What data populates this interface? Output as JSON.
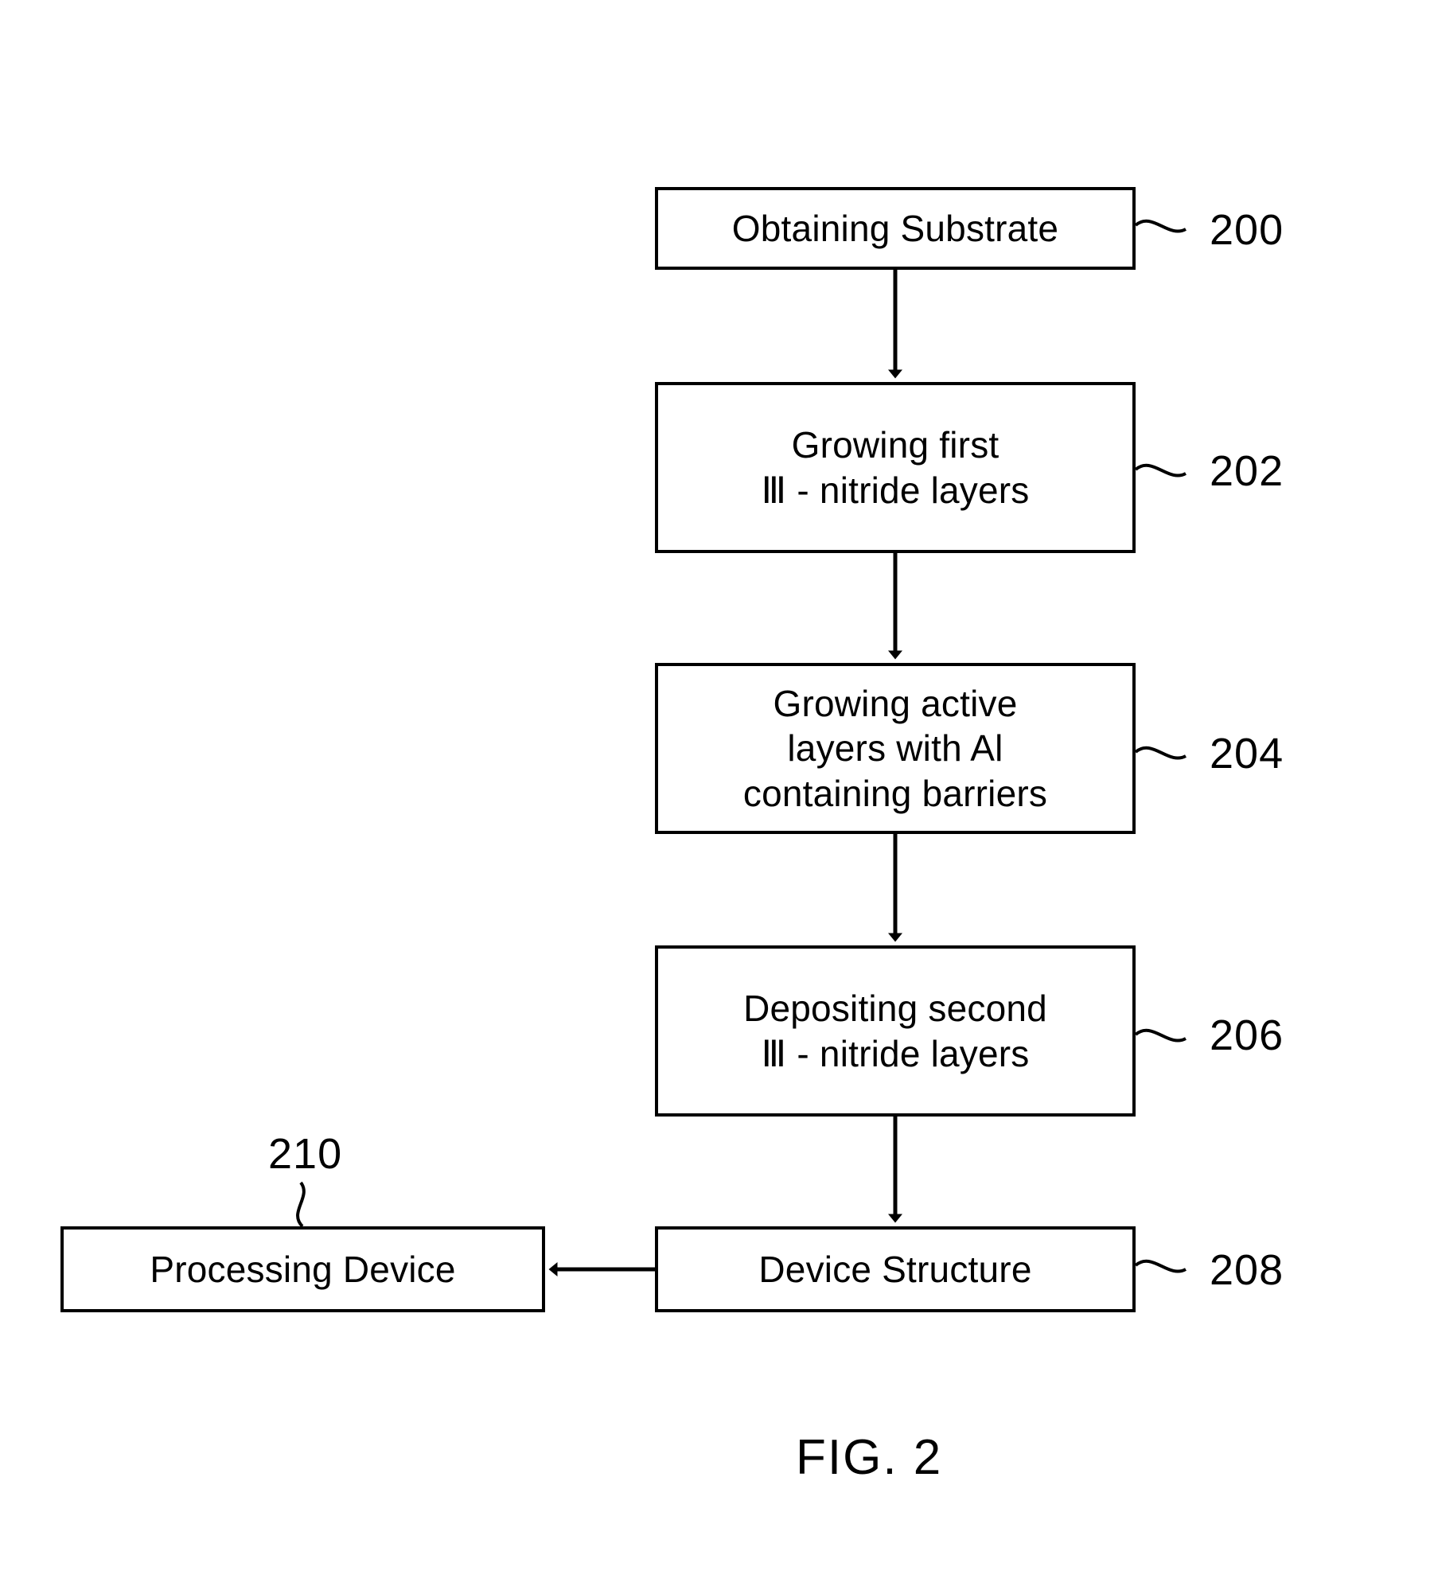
{
  "figure": {
    "caption": "FIG. 2",
    "type": "process-flowchart"
  },
  "chart_data": {
    "type": "flowchart",
    "title": "FIG. 2",
    "orientation": "vertical-top-to-bottom",
    "nodes": [
      {
        "id": "200",
        "label": "Obtaining Substrate",
        "ref": "200",
        "shape": "rectangle"
      },
      {
        "id": "202",
        "label": "Growing first\nⅢ - nitride layers",
        "ref": "202",
        "shape": "rectangle"
      },
      {
        "id": "204",
        "label": "Growing active\nlayers with Al\ncontaining barriers",
        "ref": "204",
        "shape": "rectangle"
      },
      {
        "id": "206",
        "label": "Depositing second\nⅢ - nitride layers",
        "ref": "206",
        "shape": "rectangle"
      },
      {
        "id": "208",
        "label": "Device Structure",
        "ref": "208",
        "shape": "rectangle"
      },
      {
        "id": "210",
        "label": "Processing Device",
        "ref": "210",
        "shape": "rectangle"
      }
    ],
    "edges": [
      {
        "from": "200",
        "to": "202",
        "direction": "down",
        "style": "solid-arrow"
      },
      {
        "from": "202",
        "to": "204",
        "direction": "down",
        "style": "solid-arrow"
      },
      {
        "from": "204",
        "to": "206",
        "direction": "down",
        "style": "solid-arrow"
      },
      {
        "from": "206",
        "to": "208",
        "direction": "down",
        "style": "solid-arrow"
      },
      {
        "from": "208",
        "to": "210",
        "direction": "left",
        "style": "solid-arrow"
      }
    ],
    "leaders": [
      {
        "ref": "200",
        "node": "200",
        "side": "right"
      },
      {
        "ref": "202",
        "node": "202",
        "side": "right"
      },
      {
        "ref": "204",
        "node": "204",
        "side": "right"
      },
      {
        "ref": "206",
        "node": "206",
        "side": "right"
      },
      {
        "ref": "208",
        "node": "208",
        "side": "right"
      },
      {
        "ref": "210",
        "node": "210",
        "side": "top"
      }
    ]
  },
  "boxes": {
    "obtaining_substrate": {
      "label": "Obtaining Substrate",
      "ref": "200"
    },
    "growing_first_nitride": {
      "label": "Growing first\nⅢ - nitride layers",
      "ref": "202"
    },
    "growing_active_layers": {
      "label": "Growing active\nlayers with Al\ncontaining barriers",
      "ref": "204"
    },
    "depositing_second_nitride": {
      "label": "Depositing second\nⅢ - nitride layers",
      "ref": "206"
    },
    "device_structure": {
      "label": "Device Structure",
      "ref": "208"
    },
    "processing_device": {
      "label": "Processing Device",
      "ref": "210"
    }
  },
  "colors": {
    "line": "#000000",
    "background": "#ffffff",
    "text": "#000000"
  }
}
